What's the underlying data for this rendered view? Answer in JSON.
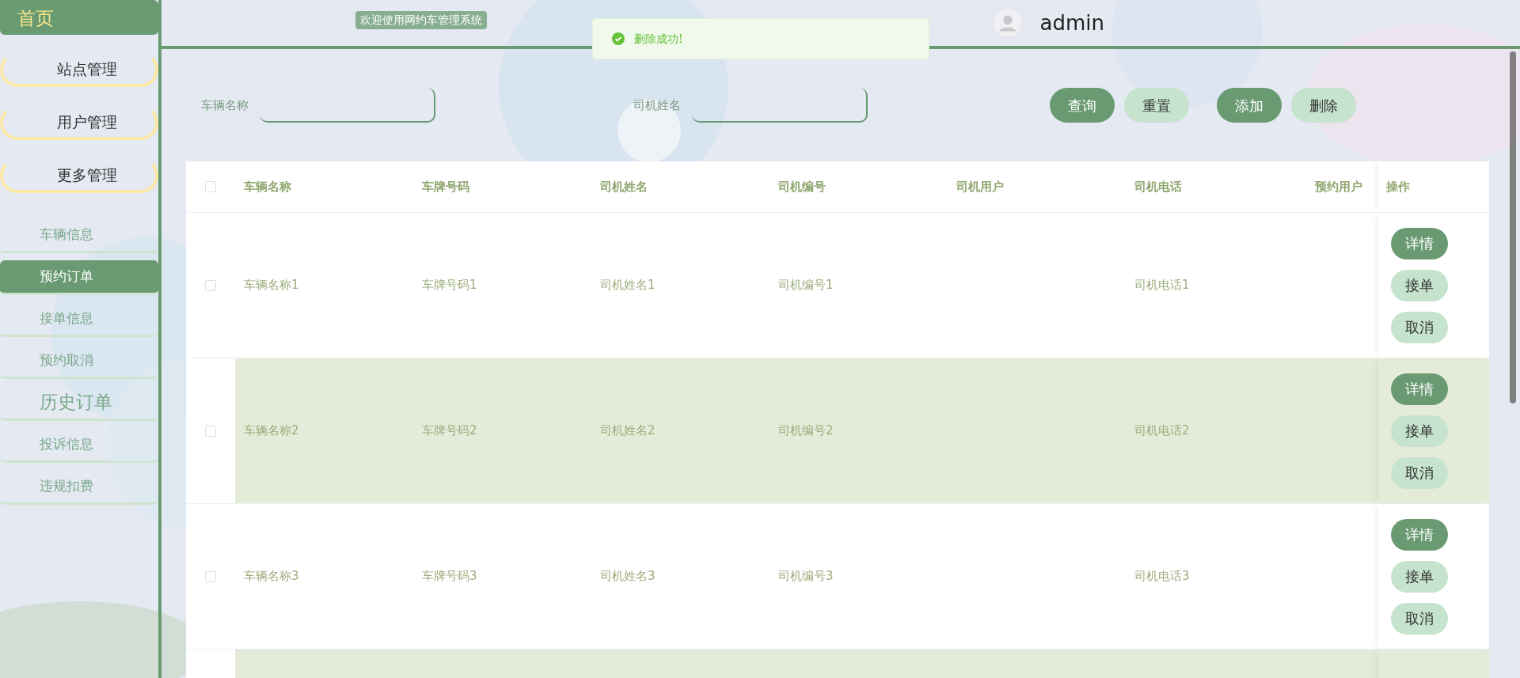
{
  "sidebar": {
    "items": [
      {
        "label": "首页",
        "kind": "home"
      },
      {
        "label": "站点管理",
        "kind": "group"
      },
      {
        "label": "用户管理",
        "kind": "group"
      },
      {
        "label": "更多管理",
        "kind": "group"
      },
      {
        "label": "车辆信息",
        "kind": "link",
        "selected": false,
        "hovered": false
      },
      {
        "label": "预约订单",
        "kind": "link",
        "selected": true,
        "hovered": false
      },
      {
        "label": "接单信息",
        "kind": "link",
        "selected": false,
        "hovered": false
      },
      {
        "label": "预约取消",
        "kind": "link",
        "selected": false,
        "hovered": false
      },
      {
        "label": "历史订单",
        "kind": "link",
        "selected": false,
        "hovered": true
      },
      {
        "label": "投诉信息",
        "kind": "link",
        "selected": false,
        "hovered": false
      },
      {
        "label": "违规扣费",
        "kind": "link",
        "selected": false,
        "hovered": false
      }
    ]
  },
  "header": {
    "welcome": "欢迎使用网约车管理系统",
    "user": "admin"
  },
  "toast": {
    "message": "删除成功!"
  },
  "search": {
    "fields": [
      {
        "label": "车辆名称"
      },
      {
        "label": "司机姓名"
      }
    ],
    "buttons": [
      {
        "label": "查询",
        "kind": "primary"
      },
      {
        "label": "重置",
        "kind": "secondary"
      },
      {
        "label": "添加",
        "kind": "primary"
      },
      {
        "label": "删除",
        "kind": "secondary"
      }
    ]
  },
  "table": {
    "all_checked": false,
    "columns": [
      "车辆名称",
      "车牌号码",
      "司机姓名",
      "司机编号",
      "司机用户",
      "司机电话",
      "预约用户",
      "操作"
    ],
    "rows": [
      {
        "checked": false,
        "cells": [
          "车辆名称1",
          "车牌号码1",
          "司机姓名1",
          "司机编号1",
          null,
          "司机电话1",
          null
        ],
        "actions": [
          {
            "label": "详情",
            "kind": "primary"
          },
          {
            "label": "接单",
            "kind": "secondary"
          },
          {
            "label": "取消",
            "kind": "secondary"
          }
        ]
      },
      {
        "checked": false,
        "cells": [
          "车辆名称2",
          "车牌号码2",
          "司机姓名2",
          "司机编号2",
          null,
          "司机电话2",
          null
        ],
        "actions": [
          {
            "label": "详情",
            "kind": "primary"
          },
          {
            "label": "接单",
            "kind": "secondary"
          },
          {
            "label": "取消",
            "kind": "secondary"
          }
        ]
      },
      {
        "checked": false,
        "cells": [
          "车辆名称3",
          "车牌号码3",
          "司机姓名3",
          "司机编号3",
          null,
          "司机电话3",
          null
        ],
        "actions": [
          {
            "label": "详情",
            "kind": "primary"
          },
          {
            "label": "接单",
            "kind": "secondary"
          },
          {
            "label": "取消",
            "kind": "secondary"
          }
        ]
      }
    ]
  }
}
